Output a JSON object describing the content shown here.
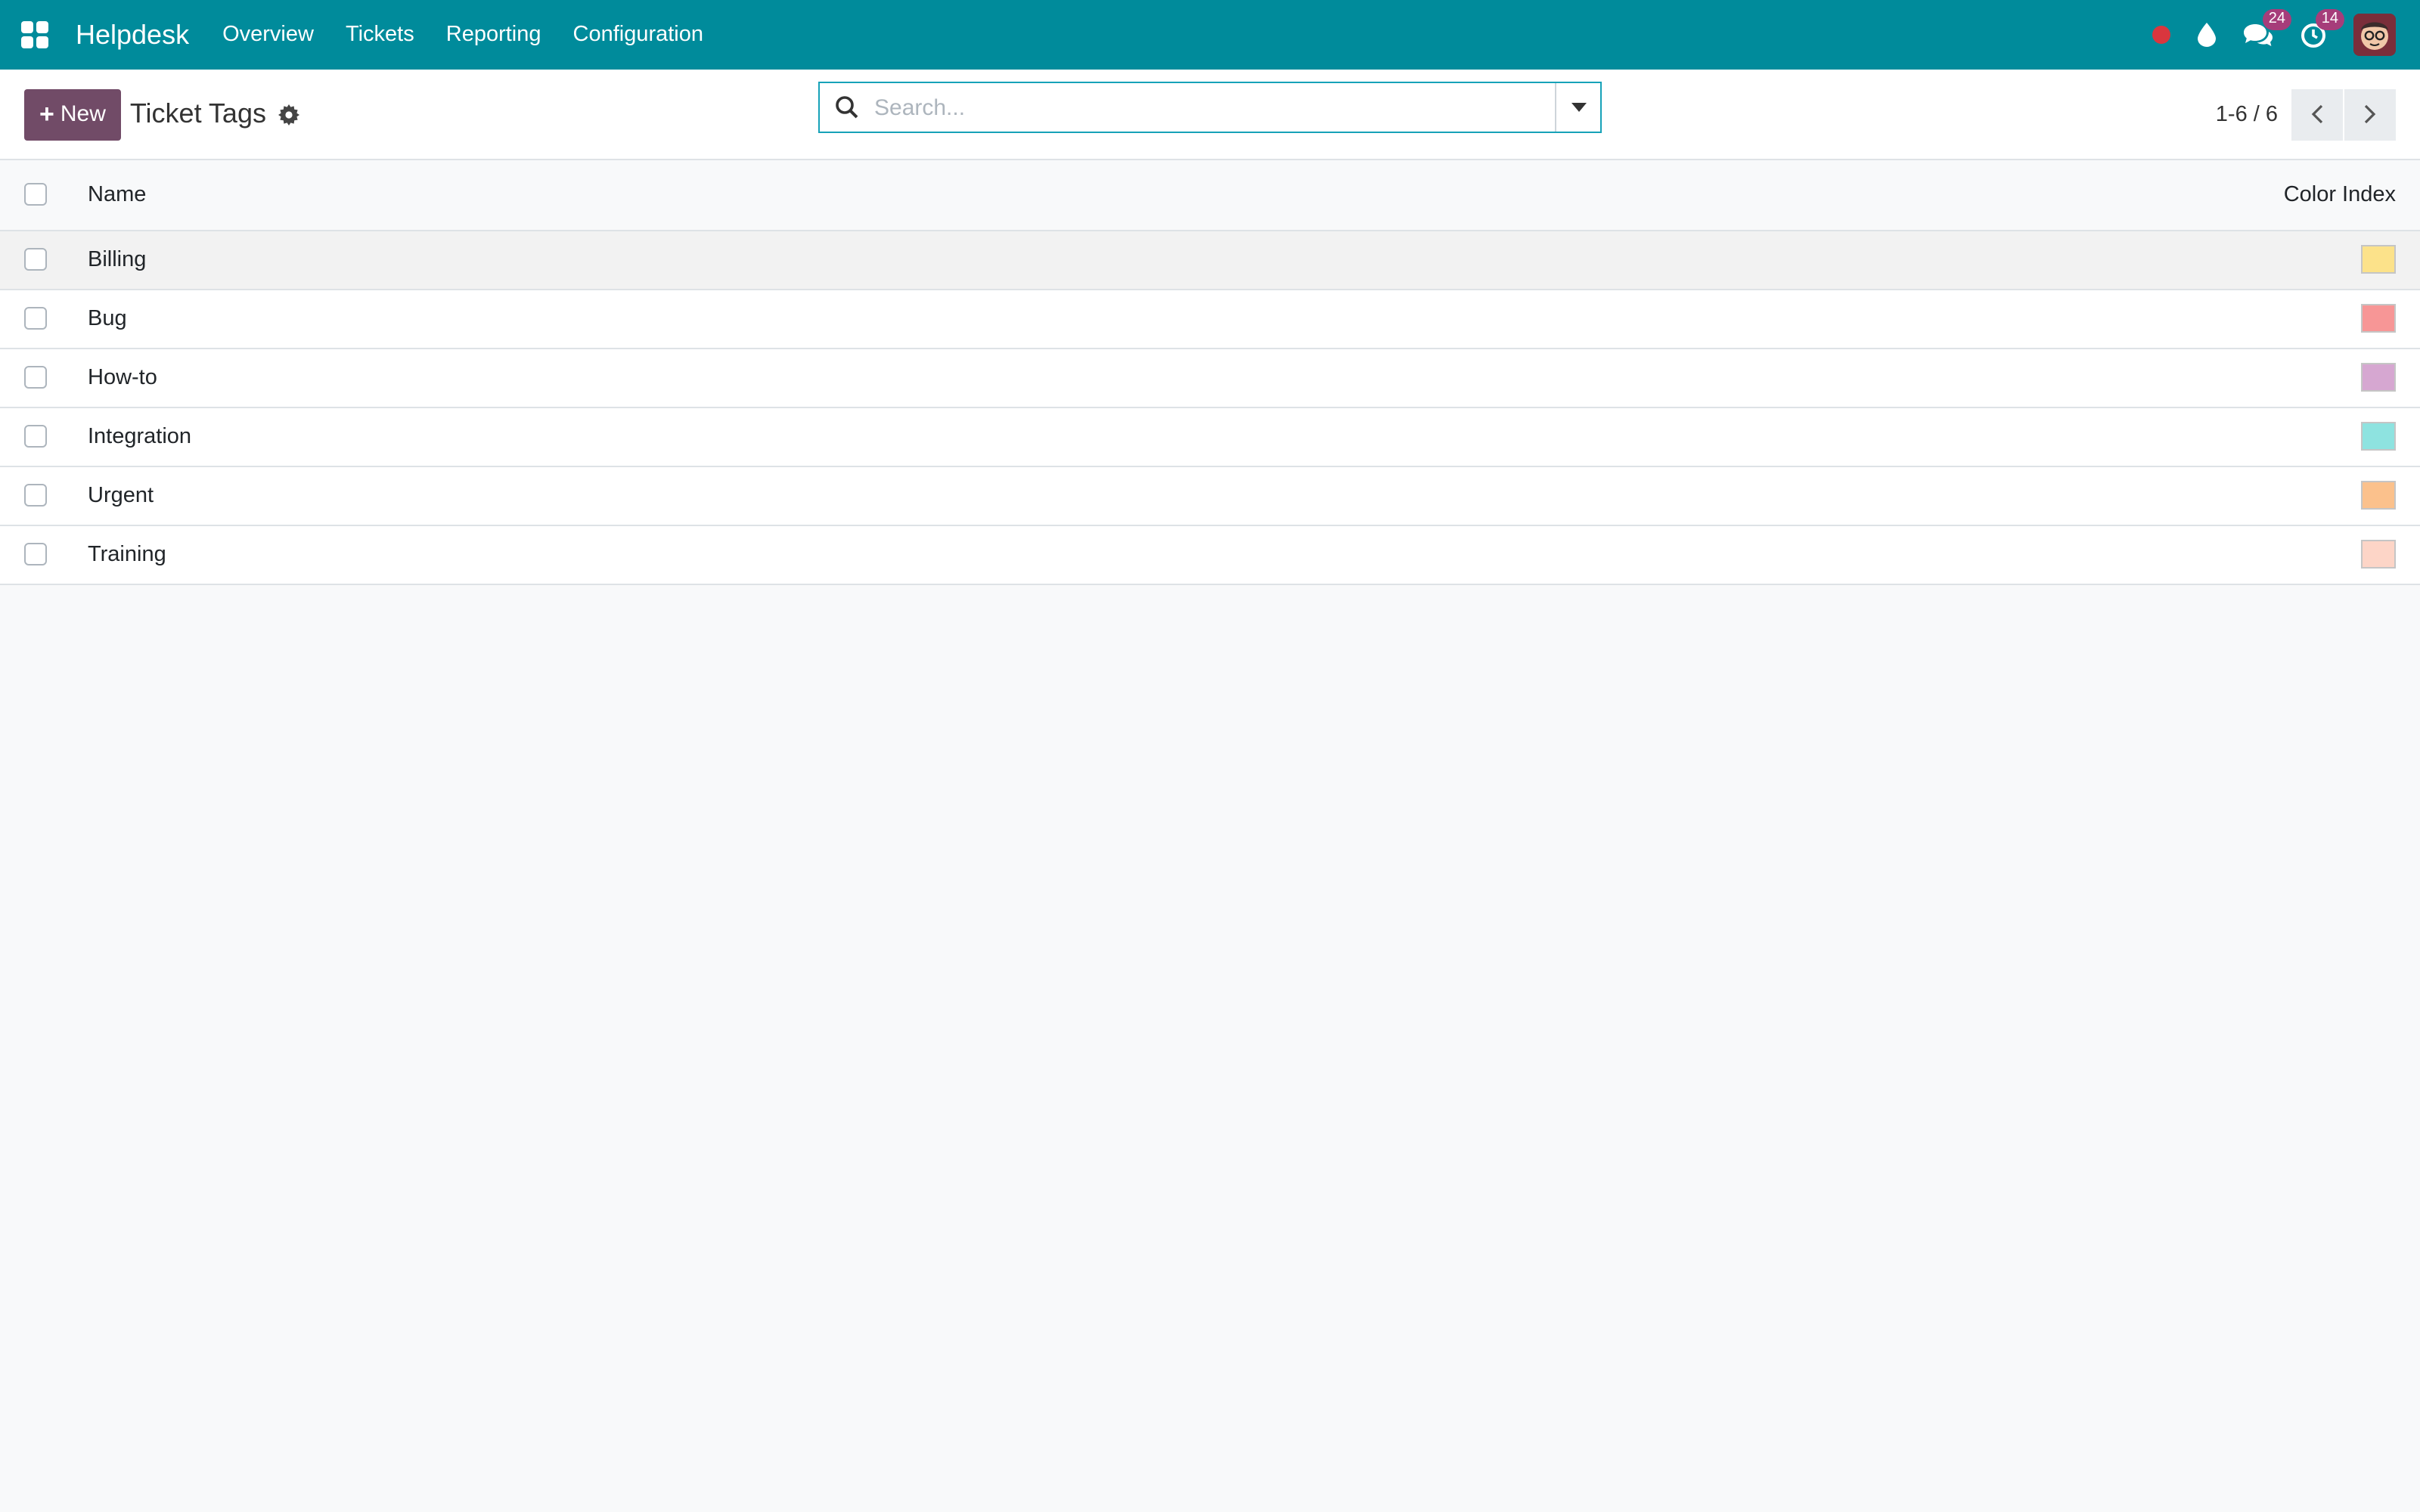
{
  "navbar": {
    "app_name": "Helpdesk",
    "menu": [
      "Overview",
      "Tickets",
      "Reporting",
      "Configuration"
    ],
    "messages_count": "24",
    "activities_count": "14"
  },
  "control": {
    "new_label": "New",
    "title": "Ticket Tags",
    "search_placeholder": "Search...",
    "pager": "1-6 / 6"
  },
  "table": {
    "columns": {
      "name": "Name",
      "color": "Color Index"
    },
    "rows": [
      {
        "name": "Billing",
        "color": "#fce28a"
      },
      {
        "name": "Bug",
        "color": "#f79696"
      },
      {
        "name": "How-to",
        "color": "#d6a7d1"
      },
      {
        "name": "Integration",
        "color": "#8ee3e0"
      },
      {
        "name": "Urgent",
        "color": "#fbc18c"
      },
      {
        "name": "Training",
        "color": "#fdd5c7"
      }
    ]
  },
  "colors": {
    "navbar": "#008b9b",
    "primary": "#714b67",
    "recording_dot": "#d9363e",
    "badge": "#a63d7a"
  }
}
